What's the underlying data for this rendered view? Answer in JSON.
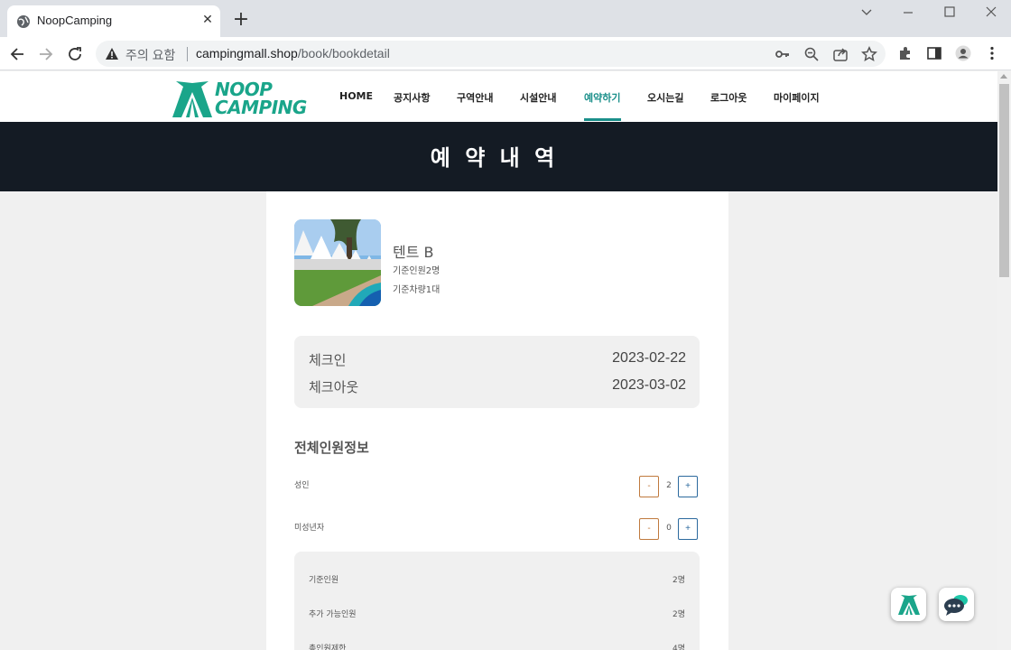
{
  "browser": {
    "tab_title": "NoopCamping",
    "security_warning": "주의 요함",
    "url_host": "campingmall.shop",
    "url_path": "/book/bookdetail"
  },
  "site": {
    "logo_line1": "NOOP",
    "logo_line2": "CAMPING",
    "nav": [
      {
        "label": "HOME"
      },
      {
        "label": "공지사항"
      },
      {
        "label": "구역안내"
      },
      {
        "label": "시설안내"
      },
      {
        "label": "예약하기",
        "active": true
      },
      {
        "label": "오시는길"
      },
      {
        "label": "로그아웃"
      },
      {
        "label": "마이페이지"
      }
    ],
    "accent_color": "#1a8f8a",
    "brand_color": "#1aa58a"
  },
  "banner": {
    "title": "예 약 내 역",
    "background": "#141b24"
  },
  "booking": {
    "site_name": "텐트 B",
    "base_people": "기준인원2명",
    "base_cars": "기준차량1대",
    "checkin_label": "체크인",
    "checkin_date": "2023-02-22",
    "checkout_label": "체크아웃",
    "checkout_date": "2023-03-02"
  },
  "guests": {
    "title": "전체인원정보",
    "adult_label": "성인",
    "adult_count": "2",
    "minor_label": "미성년자",
    "minor_count": "0",
    "minus_label": "-",
    "plus_label": "+"
  },
  "summary": {
    "rows": [
      {
        "label": "기준인원",
        "value": "2명"
      },
      {
        "label": "추가 가능인원",
        "value": "2명"
      },
      {
        "label": "총인원제한",
        "value": "4명"
      }
    ]
  }
}
